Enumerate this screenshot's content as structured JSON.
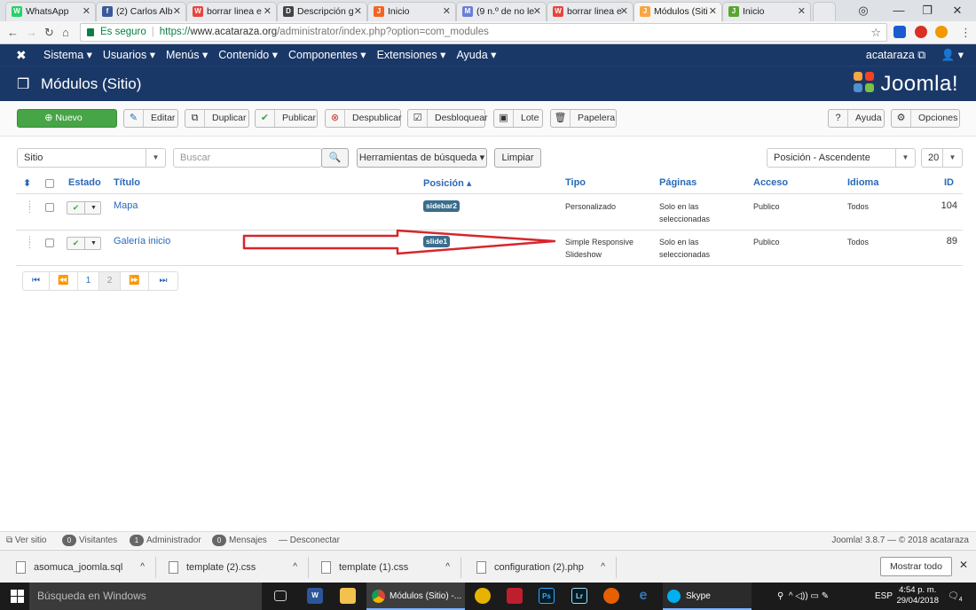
{
  "browser": {
    "tabs": [
      {
        "label": "WhatsApp",
        "color": "#25d366",
        "glyph": "W"
      },
      {
        "label": "(2) Carlos Alb",
        "color": "#3b5998",
        "glyph": "f"
      },
      {
        "label": "borrar linea e",
        "color": "#e8453c",
        "glyph": "W"
      },
      {
        "label": "Descripción g",
        "color": "#444444",
        "glyph": "D"
      },
      {
        "label": "Inicio",
        "color": "#f26522",
        "glyph": "J"
      },
      {
        "label": "(9 n.º de no le",
        "color": "#6b7fd7",
        "glyph": "M"
      },
      {
        "label": "borrar linea e",
        "color": "#e8453c",
        "glyph": "W"
      },
      {
        "label": "Módulos (Siti",
        "color": "#f9a541",
        "glyph": "J"
      },
      {
        "label": "Inicio",
        "color": "#58a62f",
        "glyph": "J"
      }
    ],
    "secure_label": "Es seguro",
    "url_scheme": "https://",
    "url_host": "www.acataraza.org",
    "url_path": "/administrator/index.php?option=com_modules"
  },
  "joomla_nav": {
    "menu": [
      "Sistema ▾",
      "Usuarios ▾",
      "Menús ▾",
      "Contenido ▾",
      "Componentes ▾",
      "Extensiones ▾",
      "Ayuda ▾"
    ],
    "site_link": "acataraza ⧉",
    "user_menu": "👤 ▾"
  },
  "page": {
    "title": "Módulos (Sitio)",
    "brand": "Joomla!"
  },
  "toolbar": {
    "new": "Nuevo",
    "edit": "Editar",
    "duplicate": "Duplicar",
    "publish": "Publicar",
    "unpublish": "Despublicar",
    "checkin": "Desbloquear",
    "batch": "Lote",
    "trash": "Papelera",
    "help": "Ayuda",
    "options": "Opciones"
  },
  "filters": {
    "client": "Sitio",
    "search_placeholder": "Buscar",
    "search_tools": "Herramientas de búsqueda ▾",
    "clear": "Limpiar",
    "ordering": "Posición - Ascendente",
    "limit": "20"
  },
  "table": {
    "headers": {
      "status": "Estado",
      "title": "Título",
      "position": "Posición ▴",
      "type": "Tipo",
      "pages": "Páginas",
      "access": "Acceso",
      "language": "Idioma",
      "id": "ID"
    },
    "rows": [
      {
        "title": "Mapa",
        "position": "sidebar2",
        "type_line1": "Personalizado",
        "type_line2": "",
        "pages_line1": "Solo en las",
        "pages_line2": "seleccionadas",
        "access": "Publico",
        "language": "Todos",
        "id": "104"
      },
      {
        "title": "Galería inicio",
        "position": "slide1",
        "type_line1": "Simple Responsive",
        "type_line2": "Slideshow",
        "pages_line1": "Solo en las",
        "pages_line2": "seleccionadas",
        "access": "Publico",
        "language": "Todos",
        "id": "89"
      }
    ]
  },
  "pagination": {
    "first": "⏮",
    "prev": "⏪",
    "pages": [
      "1",
      "2"
    ],
    "next": "⏩",
    "last": "⏭"
  },
  "statusbar": {
    "view_site": "Ver sitio",
    "visitors_count": "0",
    "visitors": "Visitantes",
    "admins_count": "1",
    "admins": "Administrador",
    "messages_count": "0",
    "messages": "Mensajes",
    "logout": "Desconectar",
    "version": "Joomla! 3.8.7 — © 2018 acataraza"
  },
  "downloads": {
    "files": [
      "asomuca_joomla.sql",
      "template (2).css",
      "template (1).css",
      "configuration (2).php"
    ],
    "show_all": "Mostrar todo"
  },
  "taskbar": {
    "search_placeholder": "Búsqueda en Windows",
    "chrome_app": "Módulos (Sitio) -...",
    "skype_app": "Skype",
    "lang": "ESP",
    "time": "4:54 p. m.",
    "date": "29/04/2018",
    "notifications": "4"
  },
  "colors": {
    "joomla_navy": "#1a3867",
    "success_green": "#46a546",
    "link_blue": "#2a69b8",
    "annotation_red": "#d7262b"
  }
}
